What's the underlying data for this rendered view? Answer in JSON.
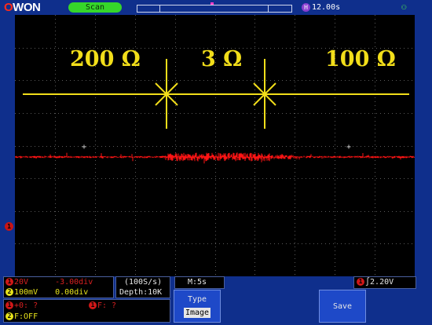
{
  "topbar": {
    "logo_prefix": "O",
    "logo_text": "WON",
    "run_state": "Scan",
    "time_icon": "H",
    "time_position": "12.00s",
    "usb_icon": "usb-icon"
  },
  "screen": {
    "ch1_marker": "1",
    "annotations": [
      "200 Ω",
      "3 Ω",
      "100 Ω"
    ]
  },
  "channel1": {
    "num": "1",
    "volts_div": "20V",
    "offset": "-3.00div"
  },
  "channel2": {
    "num": "2",
    "volts_div": "100mV",
    "offset": "0.00div"
  },
  "acquisition": {
    "rate": "(100S/s)",
    "depth": "Depth:10K"
  },
  "timebase": "M:5s",
  "trigger": {
    "channel": "1",
    "level": "2.20V"
  },
  "measurements": {
    "ch1_badge": "1",
    "ch1_freq": "+0: ?",
    "ch1_badge_b": "1",
    "ch1_period": "F: ?",
    "ch2_badge": "2",
    "ch2_freq": "F:OFF"
  },
  "menu": {
    "type_label": "Type",
    "type_value": "Image",
    "save_label": "Save"
  },
  "colors": {
    "frame": "#0f2f8c",
    "ch1": "#d01818",
    "ch2": "#e8e41c",
    "annotation": "#f2de1a"
  }
}
